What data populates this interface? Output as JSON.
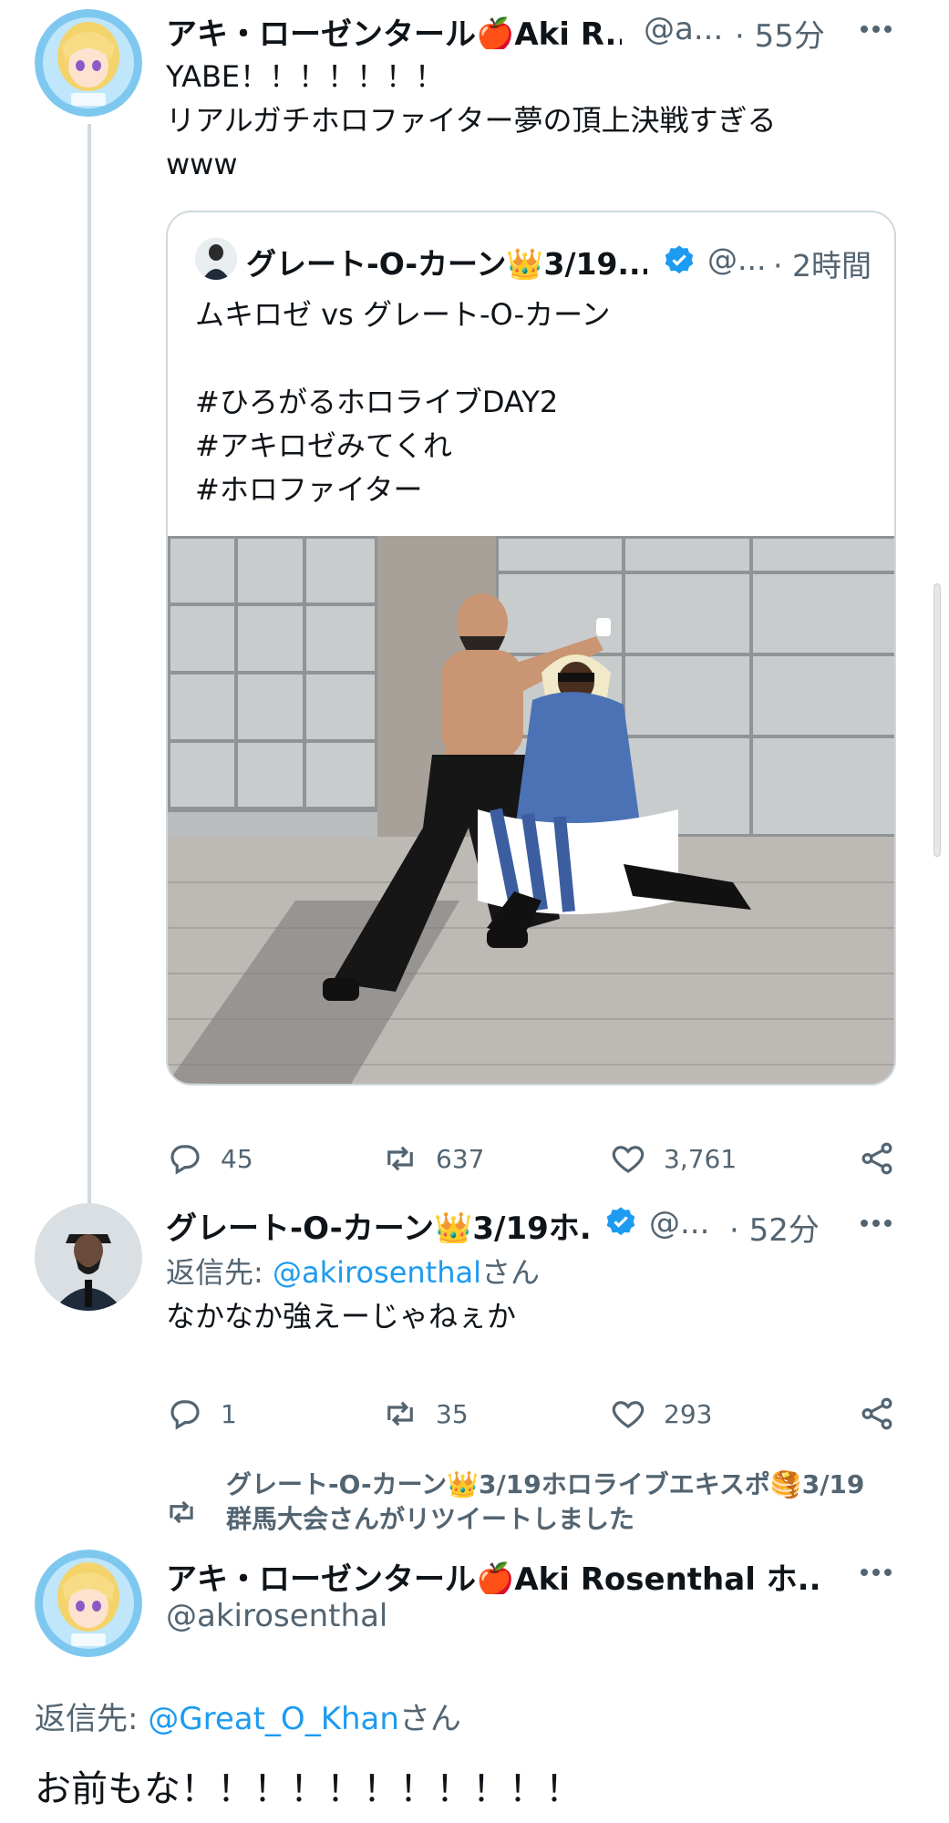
{
  "tweet1": {
    "author_name": "アキ・ローゼンタール🍎Aki R...",
    "handle": "@a...",
    "time": "· 55分",
    "text_line1": "YABE！！！！！！！",
    "text_line2": "リアルガチホロファイター夢の頂上決戦すぎる",
    "text_line3": "www",
    "quote": {
      "author_name": "グレート-O-カーン👑3/19...",
      "handle": "@...",
      "time": "· 2時間",
      "line1": "ムキロゼ vs グレート-O-カーン",
      "line2": "#ひろがるホロライブDAY2",
      "line3": "#アキロゼみてくれ",
      "line4": "#ホロファイター"
    },
    "replies": "45",
    "retweets": "637",
    "likes": "3,761"
  },
  "tweet2": {
    "author_name": "グレート-O-カーン👑3/19ホ...",
    "handle": "@...",
    "time": "· 52分",
    "reply_prefix": "返信先: ",
    "reply_to": "@akirosenthal",
    "reply_suffix": "さん",
    "text": "なかなか強えーじゃねぇか",
    "replies": "1",
    "retweets": "35",
    "likes": "293"
  },
  "retweet_banner": {
    "line1": "グレート-O-カーン👑3/19ホロライブエキスポ🥞3/19",
    "line2": "群馬大会さんがリツイートしました"
  },
  "tweet3": {
    "author_name": "アキ・ローゼンタール🍎Aki Rosenthal ホ...",
    "handle": "@akirosenthal",
    "reply_prefix": "返信先: ",
    "reply_to": "@Great_O_Khan",
    "reply_suffix": "さん",
    "text": "お前もな！！！！！！！！！！！"
  },
  "icons": {
    "more": "more-dots-icon",
    "reply": "reply-bubble-icon",
    "retweet": "retweet-icon",
    "like": "heart-icon",
    "share": "share-icon",
    "verified": "verified-badge-icon"
  },
  "colors": {
    "link": "#1d9bf0",
    "secondary": "#536471",
    "border": "#cfd9de",
    "verified": "#1d9bf0"
  }
}
